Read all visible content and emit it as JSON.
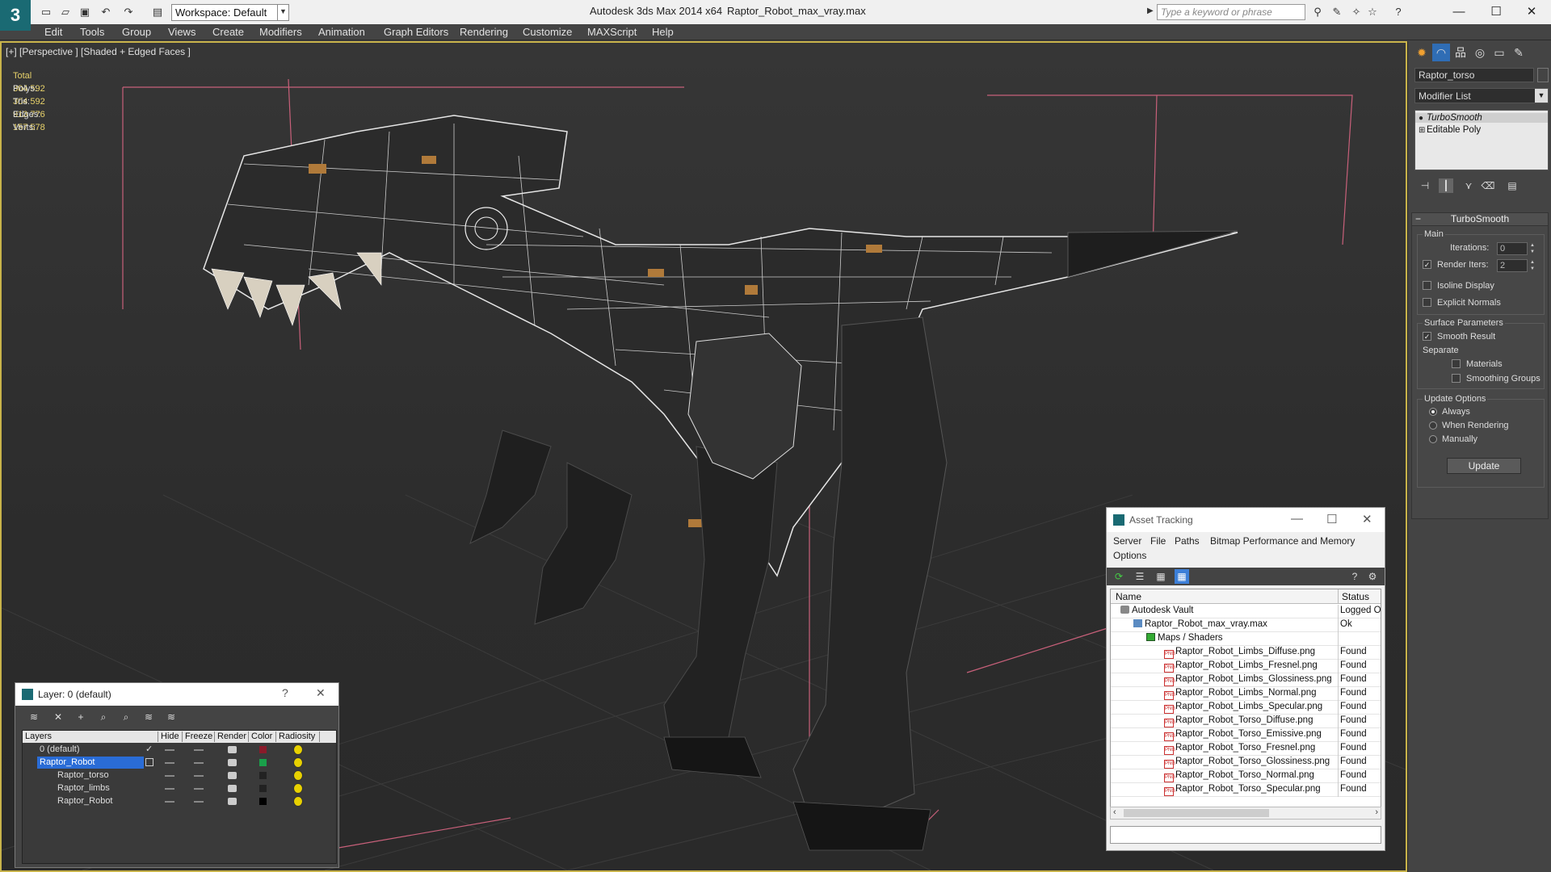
{
  "titlebar": {
    "logo": "3",
    "workspace": "Workspace: Default",
    "app_title": "Autodesk 3ds Max  2014 x64",
    "file_title": "Raptor_Robot_max_vray.max",
    "search_placeholder": "Type a keyword or phrase"
  },
  "menu": [
    "Edit",
    "Tools",
    "Group",
    "Views",
    "Create",
    "Modifiers",
    "Animation",
    "Graph Editors",
    "Rendering",
    "Customize",
    "MAXScript",
    "Help"
  ],
  "viewport": {
    "label": "[+] [Perspective ] [Shaded + Edged Faces ]",
    "stats_header": "Total",
    "stats": [
      {
        "label": "Polys:",
        "value": "304 592"
      },
      {
        "label": "Tris:",
        "value": "304 592"
      },
      {
        "label": "Edges:",
        "value": "913 776"
      },
      {
        "label": "Verts:",
        "value": "157 578"
      }
    ]
  },
  "command_panel": {
    "object_name": "Raptor_torso",
    "modifier_list": "Modifier List",
    "stack": [
      "TurboSmooth",
      "Editable Poly"
    ],
    "rollout_title": "TurboSmooth",
    "main_group": "Main",
    "iterations_label": "Iterations:",
    "iterations_value": "0",
    "render_iters_label": "Render Iters:",
    "render_iters_value": "2",
    "isoline": "Isoline Display",
    "explicit_normals": "Explicit Normals",
    "surface_group": "Surface Parameters",
    "smooth_result": "Smooth Result",
    "separate": "Separate",
    "materials": "Materials",
    "smoothing_groups": "Smoothing Groups",
    "update_group": "Update Options",
    "always": "Always",
    "when_rendering": "When Rendering",
    "manually": "Manually",
    "update_button": "Update"
  },
  "layer_window": {
    "title": "Layer: 0 (default)",
    "help": "?",
    "columns": [
      "Layers",
      "Hide",
      "Freeze",
      "Render",
      "Color",
      "Radiosity"
    ],
    "rows": [
      {
        "name": "0 (default)",
        "color": "#8a1a2a"
      },
      {
        "name": "Raptor_Robot",
        "color": "#1aa04a"
      },
      {
        "name": "Raptor_torso",
        "color": "#222222"
      },
      {
        "name": "Raptor_limbs",
        "color": "#222222"
      },
      {
        "name": "Raptor_Robot",
        "color": "#000000"
      }
    ]
  },
  "asset_window": {
    "title": "Asset Tracking",
    "menu": [
      "Server",
      "File",
      "Paths",
      "Bitmap Performance and Memory",
      "Options"
    ],
    "columns": [
      "Name",
      "Status"
    ],
    "rows": [
      {
        "name": "Autodesk Vault",
        "status": "Logged O",
        "indent": 0
      },
      {
        "name": "Raptor_Robot_max_vray.max",
        "status": "Ok",
        "indent": 1
      },
      {
        "name": "Maps / Shaders",
        "status": "",
        "indent": 2
      },
      {
        "name": "Raptor_Robot_Limbs_Diffuse.png",
        "status": "Found",
        "indent": 3
      },
      {
        "name": "Raptor_Robot_Limbs_Fresnel.png",
        "status": "Found",
        "indent": 3
      },
      {
        "name": "Raptor_Robot_Limbs_Glossiness.png",
        "status": "Found",
        "indent": 3
      },
      {
        "name": "Raptor_Robot_Limbs_Normal.png",
        "status": "Found",
        "indent": 3
      },
      {
        "name": "Raptor_Robot_Limbs_Specular.png",
        "status": "Found",
        "indent": 3
      },
      {
        "name": "Raptor_Robot_Torso_Diffuse.png",
        "status": "Found",
        "indent": 3
      },
      {
        "name": "Raptor_Robot_Torso_Emissive.png",
        "status": "Found",
        "indent": 3
      },
      {
        "name": "Raptor_Robot_Torso_Fresnel.png",
        "status": "Found",
        "indent": 3
      },
      {
        "name": "Raptor_Robot_Torso_Glossiness.png",
        "status": "Found",
        "indent": 3
      },
      {
        "name": "Raptor_Robot_Torso_Normal.png",
        "status": "Found",
        "indent": 3
      },
      {
        "name": "Raptor_Robot_Torso_Specular.png",
        "status": "Found",
        "indent": 3
      }
    ]
  }
}
